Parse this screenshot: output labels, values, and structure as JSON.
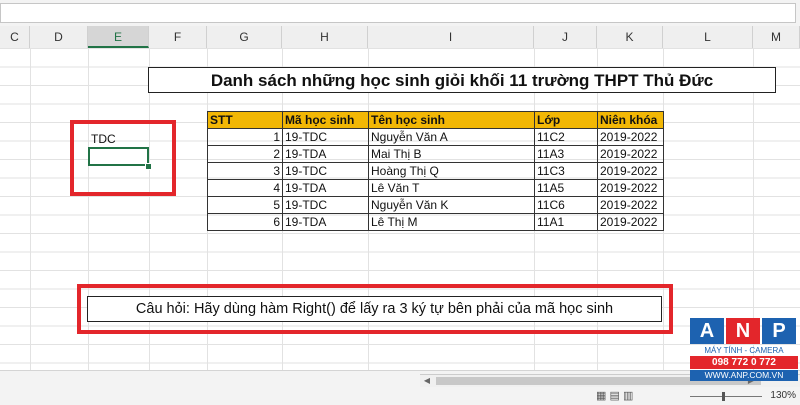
{
  "columns": [
    "C",
    "D",
    "E",
    "F",
    "G",
    "H",
    "I",
    "J",
    "K",
    "L",
    "M"
  ],
  "selected_column": "E",
  "title": "Danh sách những học sinh giỏi khối 11 trường THPT Thủ Đức",
  "cell_e": {
    "value": "TDC"
  },
  "table": {
    "headers": [
      "STT",
      "Mã học sinh",
      "Tên học sinh",
      "Lớp",
      "Niên khóa"
    ],
    "rows": [
      [
        "1",
        "19-TDC",
        "Nguyễn Văn A",
        "11C2",
        "2019-2022"
      ],
      [
        "2",
        "19-TDA",
        "Mai Thị B",
        "11A3",
        "2019-2022"
      ],
      [
        "3",
        "19-TDC",
        "Hoàng Thị Q",
        "11C3",
        "2019-2022"
      ],
      [
        "4",
        "19-TDA",
        "Lê Văn T",
        "11A5",
        "2019-2022"
      ],
      [
        "5",
        "19-TDC",
        "Nguyễn Văn K",
        "11C6",
        "2019-2022"
      ],
      [
        "6",
        "19-TDA",
        "Lê Thị M",
        "11A1",
        "2019-2022"
      ]
    ]
  },
  "question": "Câu hỏi: Hãy dùng hàm Right() để lấy ra 3 ký tự bên phải của mã học sinh",
  "zoom": "130%",
  "logo": {
    "letters": [
      "A",
      "N",
      "P"
    ],
    "tagline": "MÁY TÍNH - CAMERA",
    "phone": "098 772 0 772",
    "website": "WWW.ANP.COM.VN"
  },
  "colors": {
    "accent": "#217346",
    "highlight": "#e3262b",
    "header_fill": "#f2b705"
  }
}
